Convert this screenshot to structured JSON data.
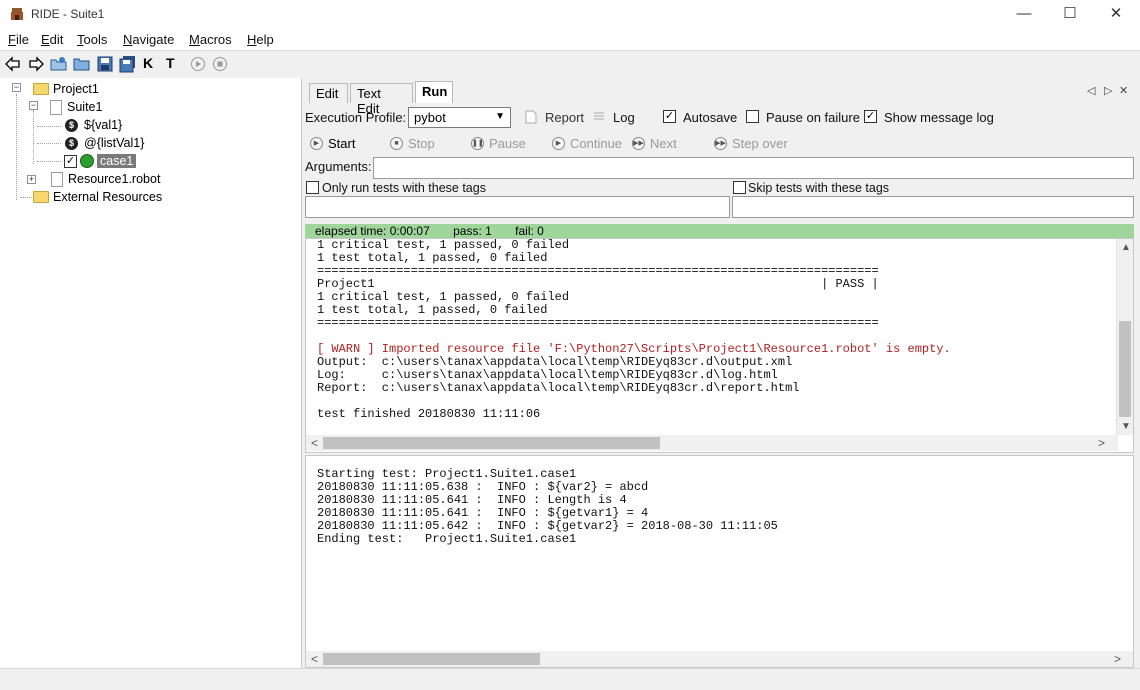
{
  "window": {
    "title": "RIDE - Suite1",
    "controls": {
      "minimize": "—",
      "maximize": "☐",
      "close": "✕"
    }
  },
  "menu": [
    {
      "label": "File",
      "key": "F",
      "rest": "ile"
    },
    {
      "label": "Edit",
      "key": "E",
      "rest": "dit"
    },
    {
      "label": "Tools",
      "key": "T",
      "rest": "ools"
    },
    {
      "label": "Navigate",
      "key": "N",
      "rest": "avigate"
    },
    {
      "label": "Macros",
      "key": "M",
      "rest": "acros"
    },
    {
      "label": "Help",
      "key": "H",
      "rest": "elp"
    }
  ],
  "toolbar": {
    "icons": [
      "back-arrow-icon",
      "forward-arrow-icon",
      "open-project-icon",
      "open-directory-icon",
      "save-icon",
      "save-all-icon",
      "search-keywords-icon",
      "search-tests-icon",
      "run-icon",
      "stop-icon"
    ],
    "keyword_glyph": "K",
    "test_glyph": "T"
  },
  "tree": {
    "project": "Project1",
    "suite": "Suite1",
    "var1": "${val1}",
    "var2": "@{listVal1}",
    "case": "case1",
    "resource": "Resource1.robot",
    "external": "External Resources",
    "case_checked": "✓",
    "expand_minus": "−",
    "expand_plus": "+",
    "var_glyph": "$"
  },
  "tabs": [
    {
      "label": "Edit",
      "active": false
    },
    {
      "label": "Text Edit",
      "active": false
    },
    {
      "label": "Run",
      "active": true
    }
  ],
  "tab_nav": {
    "left": "◁",
    "right": "▷",
    "close": "✕"
  },
  "run": {
    "profile_label": "Execution Profile:",
    "profile_value": "pybot",
    "report_label": "Report",
    "log_label": "Log",
    "autosave_label": "Autosave",
    "autosave_checked": "✓",
    "pause_label": "Pause on failure",
    "pause_checked": "",
    "show_log_label": "Show message log",
    "show_log_checked": "✓",
    "buttons": {
      "start": "Start",
      "stop": "Stop",
      "pause": "Pause",
      "continue": "Continue",
      "next": "Next",
      "step_over": "Step over"
    },
    "button_glyphs": {
      "start": "▶",
      "stop": "■",
      "pause": "❚❚",
      "continue": "▶",
      "next": "▶▶",
      "step_over": "▶▶"
    },
    "arguments_label": "Arguments:",
    "arguments_value": "",
    "only_tags_label": "Only run tests with these tags",
    "skip_tags_label": "Skip tests with these tags",
    "only_tags_value": "",
    "skip_tags_value": ""
  },
  "status": {
    "elapsed": "elapsed time: 0:00:07",
    "pass": "pass: 1",
    "fail": "fail: 0",
    "color": "#9fd59b"
  },
  "output": {
    "lines_before_warn": "1 critical test, 1 passed, 0 failed\n1 test total, 1 passed, 0 failed\n==============================================================================\nProject1                                                              | PASS |\n1 critical test, 1 passed, 0 failed\n1 test total, 1 passed, 0 failed\n==============================================================================\n\n",
    "warn_line": "[ WARN ] Imported resource file 'F:\\Python27\\Scripts\\Project1\\Resource1.robot' is empty.",
    "lines_after_warn": "\nOutput:  c:\\users\\tanax\\appdata\\local\\temp\\RIDEyq83cr.d\\output.xml\nLog:     c:\\users\\tanax\\appdata\\local\\temp\\RIDEyq83cr.d\\log.html\nReport:  c:\\users\\tanax\\appdata\\local\\temp\\RIDEyq83cr.d\\report.html\n\ntest finished 20180830 11:11:06",
    "warn_color": "#b22222"
  },
  "message_log": {
    "text": "Starting test: Project1.Suite1.case1\n20180830 11:11:05.638 :  INFO : ${var2} = abcd\n20180830 11:11:05.641 :  INFO : Length is 4\n20180830 11:11:05.641 :  INFO : ${getvar1} = 4\n20180830 11:11:05.642 :  INFO : ${getvar2} = 2018-08-30 11:11:05\nEnding test:   Project1.Suite1.case1"
  },
  "scroll_glyphs": {
    "up": "▲",
    "down": "▼",
    "left": "<",
    "right": ">"
  }
}
